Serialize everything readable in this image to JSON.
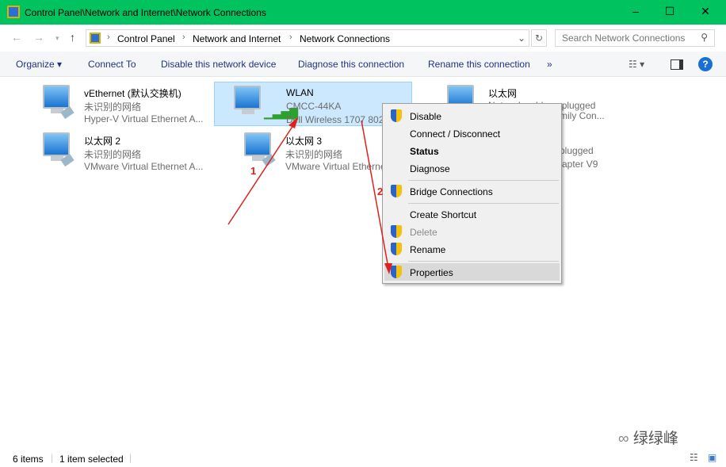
{
  "window": {
    "title": "Control Panel\\Network and Internet\\Network Connections"
  },
  "address": {
    "crumbs": [
      "Control Panel",
      "Network and Internet",
      "Network Connections"
    ],
    "search_placeholder": "Search Network Connections"
  },
  "toolbar": {
    "organize": "Organize ▾",
    "connect_to": "Connect To",
    "disable": "Disable this network device",
    "diagnose": "Diagnose this connection",
    "rename": "Rename this connection",
    "more": "»"
  },
  "items": [
    {
      "name": "vEthernet (默认交换机)",
      "status": "未识别的网络",
      "device": "Hyper-V Virtual Ethernet A..."
    },
    {
      "name": "WLAN",
      "status": "CMCC-44KA",
      "device": "Dell Wireless 1707 802.1"
    },
    {
      "name": "以太网",
      "status": "Network cable unplugged",
      "device": "mily Con..."
    },
    {
      "name": "以太网 2",
      "status": "未识别的网络",
      "device": "VMware Virtual Ethernet A..."
    },
    {
      "name": "以太网 3",
      "status": "未识别的网络",
      "device": "VMware Virtual Etherne"
    },
    {
      "name": "",
      "status": "plugged",
      "device": "apter V9"
    }
  ],
  "context_menu": [
    "Disable",
    "Connect / Disconnect",
    "Status",
    "Diagnose",
    "Bridge Connections",
    "Create Shortcut",
    "Delete",
    "Rename",
    "Properties"
  ],
  "annotations": {
    "step1": "1",
    "step2": "2",
    "annotation_color": "#e0201c"
  },
  "statusbar": {
    "count": "6 items",
    "selected": "1 item selected"
  },
  "watermark": "绿绿峰",
  "colors": {
    "titlebar": "#00c35f",
    "selection": "#cce8ff"
  }
}
